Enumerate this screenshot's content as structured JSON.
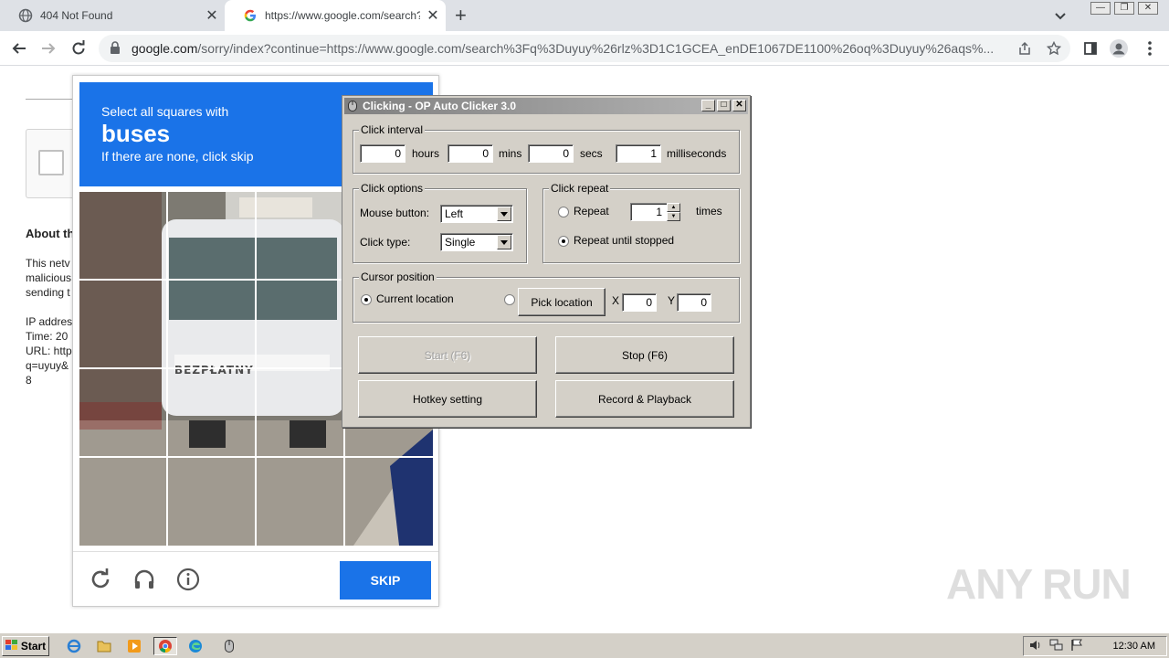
{
  "browser": {
    "tabs": [
      {
        "title": "404 Not Found",
        "active": false
      },
      {
        "title": "https://www.google.com/search?q=",
        "active": true
      }
    ],
    "new_tab": "+",
    "url_host": "google.com",
    "url_rest": "/sorry/index?continue=https://www.google.com/search%3Fq%3Duyuy%26rlz%3D1C1GCEA_enDE1067DE1100%26oq%3Duyuy%26aqs%..."
  },
  "page": {
    "about_heading": "About th",
    "body_text": "This netv\nmalicious\nsending t\n\nIP addres\nTime: 20\nURL: http\nq=uyuy&\n8"
  },
  "captcha": {
    "line1": "Select all squares with",
    "target": "buses",
    "line3": "If there are none, click skip",
    "skip_label": "SKIP",
    "image_text": "BEZPŁATNY"
  },
  "autoclicker": {
    "title": "Clicking - OP Auto Clicker 3.0",
    "interval": {
      "label": "Click interval",
      "hours": "0",
      "hours_label": "hours",
      "mins": "0",
      "mins_label": "mins",
      "secs": "0",
      "secs_label": "secs",
      "ms": "1",
      "ms_label": "milliseconds"
    },
    "options": {
      "label": "Click options",
      "mouse_label": "Mouse button:",
      "mouse_value": "Left",
      "type_label": "Click type:",
      "type_value": "Single"
    },
    "repeat": {
      "label": "Click repeat",
      "repeat_label": "Repeat",
      "repeat_count": "1",
      "times_label": "times",
      "until_label": "Repeat until stopped",
      "selected": "until_stopped"
    },
    "cursor": {
      "label": "Cursor position",
      "current_label": "Current location",
      "pick_label": "Pick location",
      "x_label": "X",
      "x": "0",
      "y_label": "Y",
      "y": "0",
      "selected": "current"
    },
    "buttons": {
      "start": "Start (F6)",
      "stop": "Stop (F6)",
      "hotkey": "Hotkey setting",
      "record": "Record & Playback"
    }
  },
  "watermark": "ANY RUN",
  "taskbar": {
    "start_label": "Start",
    "clock": "12:30 AM"
  },
  "colors": {
    "captcha_blue": "#1a73e8",
    "win_face": "#d4d0c8"
  }
}
